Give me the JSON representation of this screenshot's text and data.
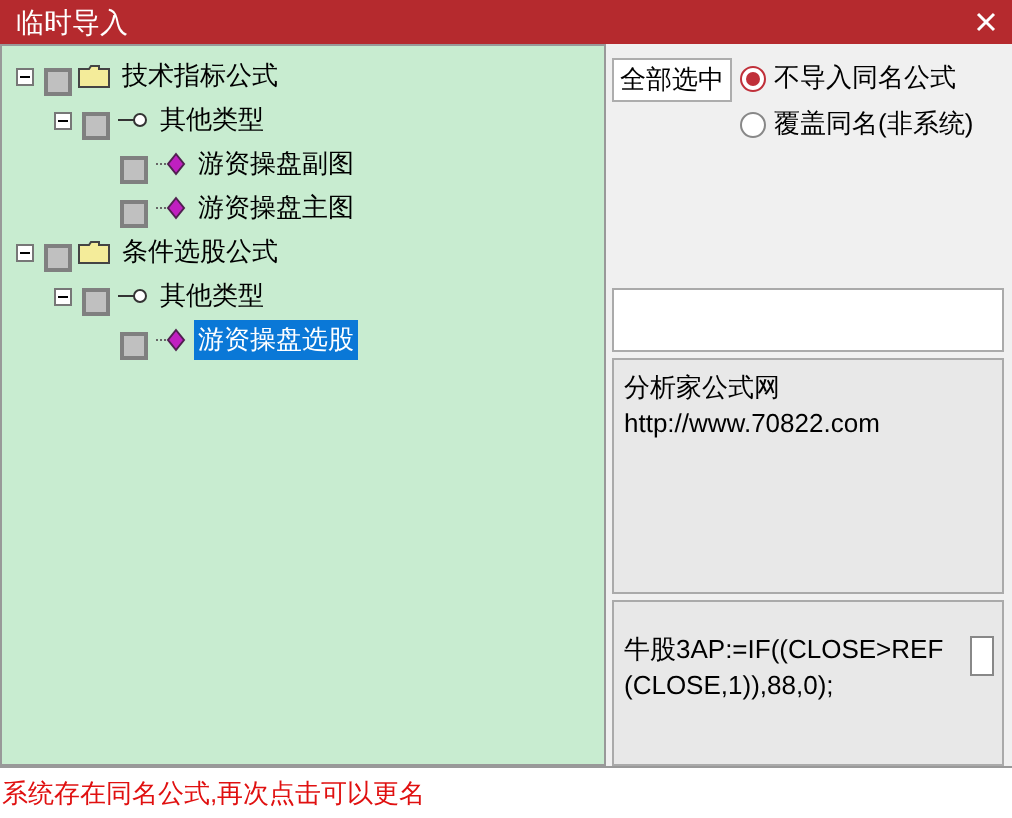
{
  "window": {
    "title": "临时导入"
  },
  "tree": [
    {
      "label": "技术指标公式",
      "kind": "folder",
      "expanded": true,
      "checked": false,
      "selected": false,
      "children": [
        {
          "label": "其他类型",
          "kind": "type",
          "expanded": true,
          "checked": false,
          "selected": false,
          "children": [
            {
              "label": "游资操盘副图",
              "kind": "formula",
              "checked": false,
              "selected": false
            },
            {
              "label": "游资操盘主图",
              "kind": "formula",
              "checked": false,
              "selected": false
            }
          ]
        }
      ]
    },
    {
      "label": "条件选股公式",
      "kind": "folder",
      "expanded": true,
      "checked": false,
      "selected": false,
      "children": [
        {
          "label": "其他类型",
          "kind": "type",
          "expanded": true,
          "checked": false,
          "selected": false,
          "children": [
            {
              "label": "游资操盘选股",
              "kind": "formula",
              "checked": false,
              "selected": true
            }
          ]
        }
      ]
    }
  ],
  "select_all_button": "全部选中",
  "options": [
    {
      "label": "不导入同名公式",
      "selected": true
    },
    {
      "label": "覆盖同名(非系统)",
      "selected": false
    }
  ],
  "description": [
    "分析家公式网",
    "http://www.70822.com"
  ],
  "code": [
    "牛股3AP:=IF((CLOSE>REF",
    "(CLOSE,1)),88,0);"
  ],
  "status": "系统存在同名公式,再次点击可以更名"
}
